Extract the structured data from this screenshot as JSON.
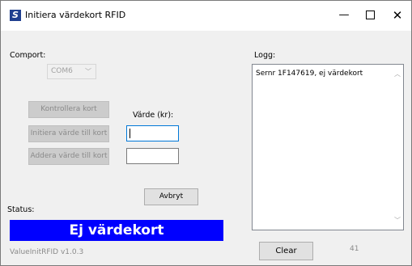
{
  "window": {
    "title": "Initiera värdekort RFID",
    "app_icon_letter": "S",
    "minimize_glyph": "—",
    "close_glyph": "✕"
  },
  "comport": {
    "label": "Comport:",
    "value": "COM6"
  },
  "buttons": {
    "kontrollera": "Kontrollera kort",
    "initiera": "Initiera värde till kort",
    "addera": "Addera värde till kort",
    "avbryt": "Avbryt",
    "clear": "Clear"
  },
  "varde": {
    "label": "Värde (kr):",
    "value1": "",
    "value2": ""
  },
  "status": {
    "label": "Status:",
    "text": "Ej värdekort",
    "color": "#0000ff"
  },
  "version": "ValueInitRFID v1.0.3",
  "log": {
    "label": "Logg:",
    "lines": [
      "Sernr 1F147619, ej värdekort"
    ]
  },
  "counter": "41"
}
